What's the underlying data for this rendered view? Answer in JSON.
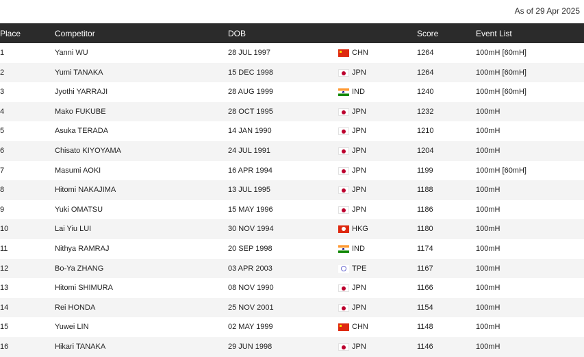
{
  "as_of": "As of 29 Apr 2025",
  "headers": {
    "place": "Place",
    "competitor": "Competitor",
    "dob": "DOB",
    "score": "Score",
    "event_list": "Event List"
  },
  "flag_colors": {
    "CHN": "#de2910",
    "JPN": "#bc002d",
    "IND": "#ff9933",
    "HKG": "#de2910",
    "TPE": "#6a6ad0"
  },
  "rows": [
    {
      "place": "1",
      "competitor": "Yanni WU",
      "dob": "28 JUL 1997",
      "nat": "CHN",
      "score": "1264",
      "events": "100mH [60mH]"
    },
    {
      "place": "2",
      "competitor": "Yumi TANAKA",
      "dob": "15 DEC 1998",
      "nat": "JPN",
      "score": "1264",
      "events": "100mH [60mH]"
    },
    {
      "place": "3",
      "competitor": "Jyothi YARRAJI",
      "dob": "28 AUG 1999",
      "nat": "IND",
      "score": "1240",
      "events": "100mH [60mH]"
    },
    {
      "place": "4",
      "competitor": "Mako FUKUBE",
      "dob": "28 OCT 1995",
      "nat": "JPN",
      "score": "1232",
      "events": "100mH"
    },
    {
      "place": "5",
      "competitor": "Asuka TERADA",
      "dob": "14 JAN 1990",
      "nat": "JPN",
      "score": "1210",
      "events": "100mH"
    },
    {
      "place": "6",
      "competitor": "Chisato KIYOYAMA",
      "dob": "24 JUL 1991",
      "nat": "JPN",
      "score": "1204",
      "events": "100mH"
    },
    {
      "place": "7",
      "competitor": "Masumi AOKI",
      "dob": "16 APR 1994",
      "nat": "JPN",
      "score": "1199",
      "events": "100mH [60mH]"
    },
    {
      "place": "8",
      "competitor": "Hitomi NAKAJIMA",
      "dob": "13 JUL 1995",
      "nat": "JPN",
      "score": "1188",
      "events": "100mH"
    },
    {
      "place": "9",
      "competitor": "Yuki OMATSU",
      "dob": "15 MAY 1996",
      "nat": "JPN",
      "score": "1186",
      "events": "100mH"
    },
    {
      "place": "10",
      "competitor": "Lai Yiu LUI",
      "dob": "30 NOV 1994",
      "nat": "HKG",
      "score": "1180",
      "events": "100mH"
    },
    {
      "place": "11",
      "competitor": "Nithya RAMRAJ",
      "dob": "20 SEP 1998",
      "nat": "IND",
      "score": "1174",
      "events": "100mH"
    },
    {
      "place": "12",
      "competitor": "Bo-Ya ZHANG",
      "dob": "03 APR 2003",
      "nat": "TPE",
      "score": "1167",
      "events": "100mH"
    },
    {
      "place": "13",
      "competitor": "Hitomi SHIMURA",
      "dob": "08 NOV 1990",
      "nat": "JPN",
      "score": "1166",
      "events": "100mH"
    },
    {
      "place": "14",
      "competitor": "Rei HONDA",
      "dob": "25 NOV 2001",
      "nat": "JPN",
      "score": "1154",
      "events": "100mH"
    },
    {
      "place": "15",
      "competitor": "Yuwei LIN",
      "dob": "02 MAY 1999",
      "nat": "CHN",
      "score": "1148",
      "events": "100mH"
    },
    {
      "place": "16",
      "competitor": "Hikari TANAKA",
      "dob": "29 JUN 1998",
      "nat": "JPN",
      "score": "1146",
      "events": "100mH"
    }
  ]
}
